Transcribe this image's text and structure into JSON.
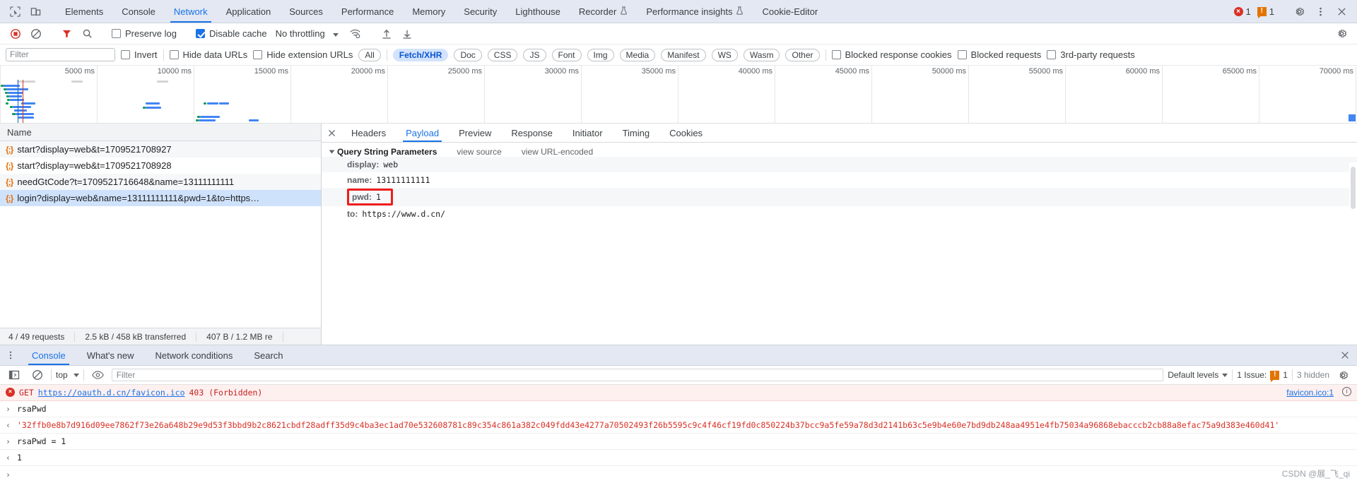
{
  "main_tabs": {
    "items": [
      {
        "label": "Elements",
        "active": false
      },
      {
        "label": "Console",
        "active": false
      },
      {
        "label": "Network",
        "active": true
      },
      {
        "label": "Application",
        "active": false
      },
      {
        "label": "Sources",
        "active": false
      },
      {
        "label": "Performance",
        "active": false
      },
      {
        "label": "Memory",
        "active": false
      },
      {
        "label": "Security",
        "active": false
      },
      {
        "label": "Lighthouse",
        "active": false
      },
      {
        "label": "Recorder",
        "active": false,
        "beaker": true
      },
      {
        "label": "Performance insights",
        "active": false,
        "beaker": true
      },
      {
        "label": "Cookie-Editor",
        "active": false
      }
    ],
    "error_count": "1",
    "warning_count": "1",
    "error_glyph": "×",
    "warning_glyph": "!",
    "settings_icon": "gear-icon",
    "more_icon": "kebab-menu-icon",
    "close_icon": "close-icon"
  },
  "network_toolbar": {
    "record_icon": "record-stop-icon",
    "clear_icon": "clear-icon",
    "filter_icon": "funnel-icon",
    "search_icon": "search-icon",
    "preserve_log": {
      "label": "Preserve log",
      "checked": false
    },
    "disable_cache": {
      "label": "Disable cache",
      "checked": true
    },
    "throttling": "No throttling",
    "wifi_icon": "network-conditions-icon",
    "import_icon": "import-har-icon",
    "export_icon": "export-har-icon",
    "settings_icon": "gear-icon"
  },
  "filter_bar": {
    "filter_placeholder": "Filter",
    "filter_value": "",
    "invert": {
      "label": "Invert",
      "checked": false
    },
    "hide_data_urls": {
      "label": "Hide data URLs",
      "checked": false
    },
    "hide_extension_urls": {
      "label": "Hide extension URLs",
      "checked": false
    },
    "type_chips": [
      {
        "label": "All",
        "selected": false
      },
      {
        "label": "Fetch/XHR",
        "selected": true
      },
      {
        "label": "Doc",
        "selected": false
      },
      {
        "label": "CSS",
        "selected": false
      },
      {
        "label": "JS",
        "selected": false
      },
      {
        "label": "Font",
        "selected": false
      },
      {
        "label": "Img",
        "selected": false
      },
      {
        "label": "Media",
        "selected": false
      },
      {
        "label": "Manifest",
        "selected": false
      },
      {
        "label": "WS",
        "selected": false
      },
      {
        "label": "Wasm",
        "selected": false
      },
      {
        "label": "Other",
        "selected": false
      }
    ],
    "blocked_response_cookies": {
      "label": "Blocked response cookies",
      "checked": false
    },
    "blocked_requests": {
      "label": "Blocked requests",
      "checked": false
    },
    "third_party_requests": {
      "label": "3rd-party requests",
      "checked": false
    }
  },
  "overview": {
    "ticks": [
      "5000 ms",
      "10000 ms",
      "15000 ms",
      "20000 ms",
      "25000 ms",
      "30000 ms",
      "35000 ms",
      "40000 ms",
      "45000 ms",
      "50000 ms",
      "55000 ms",
      "60000 ms",
      "65000 ms",
      "70000 ms"
    ]
  },
  "requests": {
    "column_header": "Name",
    "rows": [
      {
        "name": "start?display=web&t=1709521708927",
        "selected": false
      },
      {
        "name": "start?display=web&t=1709521708928",
        "selected": false
      },
      {
        "name": "needGtCode?t=1709521716648&name=13111111111",
        "selected": false
      },
      {
        "name": "login?display=web&name=13111111111&pwd=1&to=https…",
        "selected": true
      }
    ],
    "summary": [
      "4 / 49 requests",
      "2.5 kB / 458 kB transferred",
      "407 B / 1.2 MB re"
    ]
  },
  "detail": {
    "close_icon": "close-icon",
    "tabs": [
      {
        "label": "Headers",
        "active": false
      },
      {
        "label": "Payload",
        "active": true
      },
      {
        "label": "Preview",
        "active": false
      },
      {
        "label": "Response",
        "active": false
      },
      {
        "label": "Initiator",
        "active": false
      },
      {
        "label": "Timing",
        "active": false
      },
      {
        "label": "Cookies",
        "active": false
      }
    ],
    "section_title": "Query String Parameters",
    "view_source": "view source",
    "view_url_encoded": "view URL-encoded",
    "params": [
      {
        "key": "display:",
        "value": "web",
        "highlighted": false
      },
      {
        "key": "name:",
        "value": "13111111111",
        "highlighted": false
      },
      {
        "key": "pwd:",
        "value": "1",
        "highlighted": true
      },
      {
        "key": "to:",
        "value": "https://www.d.cn/",
        "highlighted": false
      }
    ],
    "highlight_color": "#ef1c1c"
  },
  "drawer": {
    "more_icon": "kebab-menu-icon",
    "tabs": [
      {
        "label": "Console",
        "active": true
      },
      {
        "label": "What's new",
        "active": false
      },
      {
        "label": "Network conditions",
        "active": false
      },
      {
        "label": "Search",
        "active": false
      }
    ],
    "close_icon": "close-icon",
    "toolbar": {
      "sidebar_icon": "console-sidebar-icon",
      "clear_icon": "clear-console-icon",
      "context": "top",
      "eye_icon": "live-expression-icon",
      "filter_placeholder": "Filter",
      "filter_value": "",
      "levels": "Default levels",
      "issues_label": "1 Issue:",
      "issues_count": "1",
      "hidden": "3 hidden",
      "settings_icon": "gear-icon"
    },
    "logs": [
      {
        "type": "error",
        "prefix": "GET",
        "link": "https://oauth.d.cn/favicon.ico",
        "suffix": "403 (Forbidden)",
        "source": "favicon.ico:1"
      },
      {
        "type": "input",
        "text": "rsaPwd"
      },
      {
        "type": "result",
        "text": "'32ffb0e8b7d916d09ee7862f73e26a648b29e9d53f3bbd9b2c8621cbdf28adff35d9c4ba3ec1ad70e532608781c89c354c861a382c049fdd43e4277a70502493f26b5595c9c4f46cf19fd0c850224b37bcc9a5fe59a78d3d2141b63c5e9b4e60e7bd9db248aa4951e4fb75034a96868ebacccb2cb88a8efac75a9d383e460d41'"
      },
      {
        "type": "input",
        "text": "rsaPwd = 1"
      },
      {
        "type": "result",
        "text": "1"
      }
    ],
    "prompt_glyph": "›"
  },
  "watermark": "CSDN @展_飞_qi"
}
